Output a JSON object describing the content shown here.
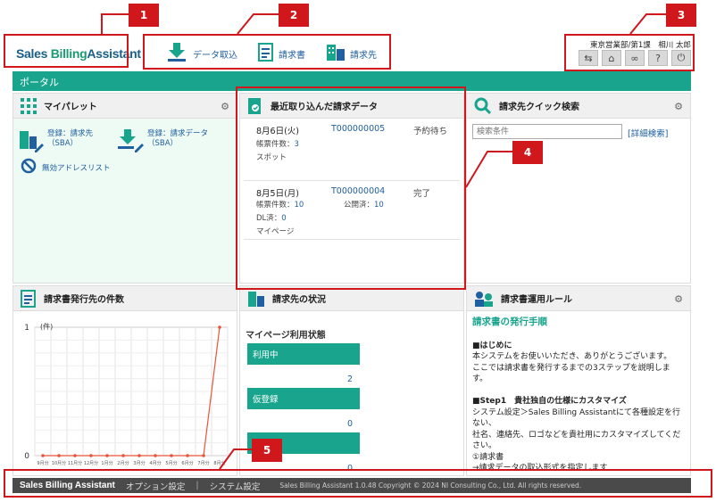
{
  "header": {
    "logo_part1": "Sales ",
    "logo_part2": "Billing",
    "logo_part3": "Assistant",
    "nav": [
      {
        "label": "データ取込",
        "icon": "import-icon"
      },
      {
        "label": "請求書",
        "icon": "invoice-icon"
      },
      {
        "label": "請求先",
        "icon": "building-icon"
      }
    ],
    "user": "東京営業部/第1課　相川 太郎",
    "tools": [
      "switch-icon",
      "home-icon",
      "link-icon",
      "help-icon",
      "power-icon"
    ]
  },
  "portal": {
    "label": "ポータル"
  },
  "mypallet": {
    "title": "マイパレット",
    "items": [
      {
        "label": "登録：請求先（SBA）"
      },
      {
        "label": "登録：請求データ（SBA）"
      },
      {
        "label": "無効アドレスリスト"
      }
    ]
  },
  "recent": {
    "title": "最近取り込んだ請求データ",
    "records": [
      {
        "date": "8月6日(火)",
        "number": "T000000005",
        "status": "予約待ち",
        "count_label": "帳票件数：",
        "count": "3",
        "type": "スポット"
      },
      {
        "date": "8月5日(月)",
        "number": "T000000004",
        "status": "完了",
        "count_label": "帳票件数：",
        "count": "10",
        "public_label": "公開済：",
        "public": "10",
        "dl_label": "DL済：",
        "dl": "0",
        "type": "マイページ"
      }
    ]
  },
  "quick_search": {
    "title": "請求先クイック検索",
    "placeholder": "検索条件",
    "detail_link": "[詳細検索]"
  },
  "issue_count": {
    "title": "請求書発行先の件数",
    "unit": "(件)"
  },
  "chart_data": {
    "type": "line",
    "categories": [
      "9月分",
      "10月分",
      "11月分",
      "12月分",
      "1月分",
      "2月分",
      "3月分",
      "4月分",
      "5月分",
      "6月分",
      "7月分",
      "8月分"
    ],
    "series": [
      {
        "values": [
          0,
          0,
          0,
          0,
          0,
          0,
          0,
          0,
          0,
          0,
          0,
          1
        ],
        "color": "#e8553a"
      }
    ],
    "ylabel": "(件)",
    "yticks": [
      "1",
      "0"
    ],
    "ylim": [
      0,
      1
    ],
    "grid": true
  },
  "customer_status": {
    "title": "請求先の状況",
    "subtitle": "マイページ利用状態",
    "rows": [
      {
        "label": "利用中",
        "value": "2"
      },
      {
        "label": "仮登録",
        "value": "0"
      },
      {
        "label": "",
        "value": "0"
      }
    ]
  },
  "rules": {
    "title": "請求書運用ルール",
    "heading": "請求書の発行手順",
    "lines": [
      {
        "text": "■はじめに",
        "bold": true
      },
      {
        "text": "本システムをお使いいただき、ありがとうございます。",
        "bold": false
      },
      {
        "text": "ここでは請求書を発行するまでの3ステップを説明します。",
        "bold": false
      },
      {
        "text": "",
        "bold": false
      },
      {
        "text": "■Step1　貴社独自の仕様にカスタマイズ",
        "bold": true
      },
      {
        "text": "システム設定＞Sales Billing Assistantにて各種設定を行ない、",
        "bold": false
      },
      {
        "text": "社名、連絡先、ロゴなどを貴社用にカスタマイズしてください。",
        "bold": false
      },
      {
        "text": "①請求書",
        "bold": false
      },
      {
        "text": "→請求データの取込形式を指定します",
        "bold": false
      }
    ]
  },
  "footer": {
    "logo": "Sales Billing Assistant",
    "option": "オプション設定",
    "sep": "|",
    "system": "システム設定",
    "copyright": "Sales Billing Assistant 1.0.48 Copyright © 2024 NI Consulting Co., Ltd. All rights reserved."
  },
  "annotations": [
    "1",
    "2",
    "3",
    "4",
    "5"
  ],
  "colors": {
    "accent": "#19a58d",
    "link": "#2060a0",
    "annotation": "#d0171b"
  }
}
